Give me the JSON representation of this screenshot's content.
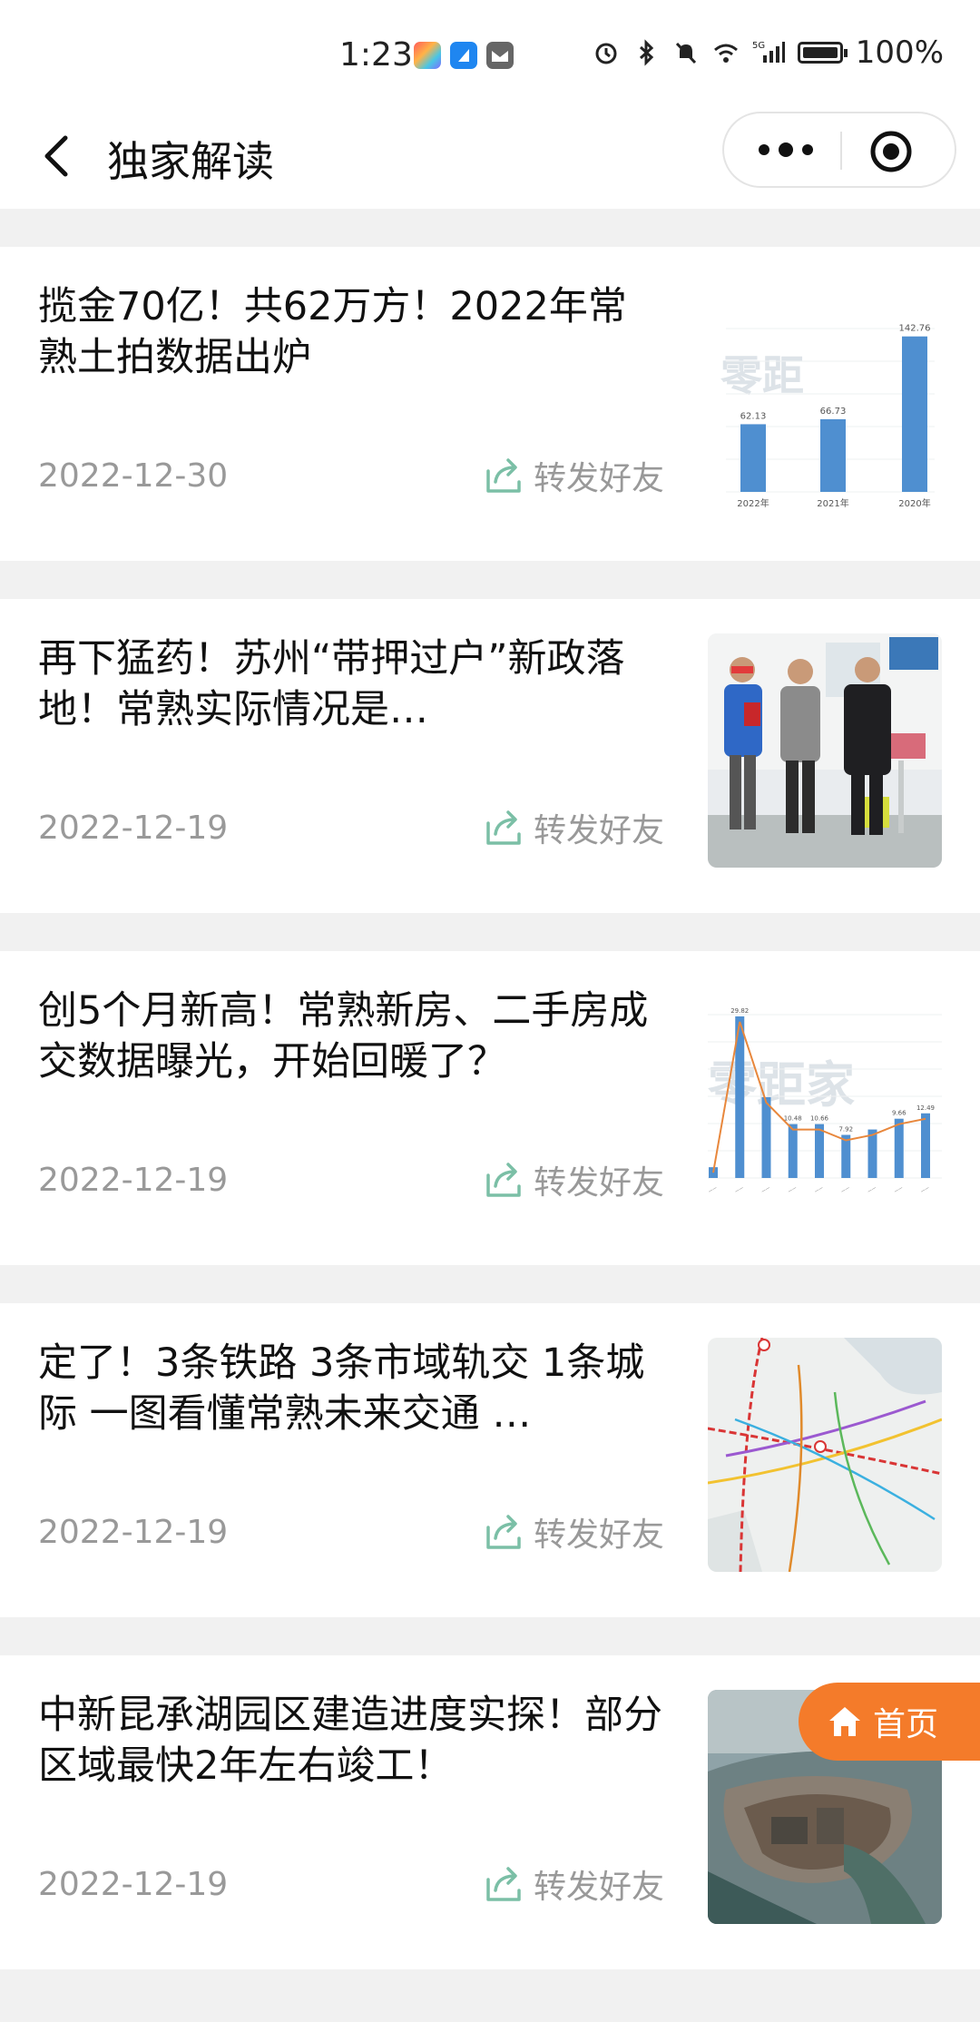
{
  "status_bar": {
    "time": "1:23",
    "battery": "100%",
    "battery_level": 1.0,
    "app_icons": [
      "colorful-app-icon",
      "blue-app-icon",
      "gray-mail-icon"
    ],
    "right_icons": [
      "alarm-icon",
      "bluetooth-icon",
      "mute-icon",
      "wifi-icon",
      "signal-5g-icon"
    ]
  },
  "nav": {
    "title": "独家解读",
    "icons": [
      "back-chevron-icon",
      "more-dots-icon",
      "close-target-icon"
    ]
  },
  "share_label": "转发好友",
  "articles": [
    {
      "title": "揽金70亿！共62万方！2022年常熟土拍数据出炉",
      "date": "2022-12-30",
      "thumb": {
        "kind": "bar-chart",
        "watermark": "零距",
        "categories": [
          "2022年",
          "2021年",
          "2020年"
        ],
        "values": [
          62.13,
          66.73,
          142.76
        ],
        "value_labels": [
          "62.13",
          "66.73",
          "142.76"
        ]
      }
    },
    {
      "title": "再下猛药！苏州“带押过户”新政落地！常熟实际情况是…",
      "date": "2022-12-19",
      "thumb": {
        "kind": "photo",
        "subject": "three men in office holding certificate"
      }
    },
    {
      "title": "创5个月新高！常熟新房、二手房成交数据曝光，开始回暖了？",
      "date": "2022-12-19",
      "thumb": {
        "kind": "bar-line-chart",
        "watermark": "零距家",
        "values": [
          2,
          30,
          15,
          10,
          10,
          8,
          9,
          11,
          12
        ],
        "value_labels": [
          "",
          "29.82",
          "",
          "10.48",
          "10.66",
          "7.92",
          "",
          "9.66",
          "12.49"
        ]
      }
    },
    {
      "title": "定了！3条铁路 3条市域轨交 1条城际 一图看懂常熟未来交通 …",
      "date": "2022-12-19",
      "thumb": {
        "kind": "map",
        "subject": "transit map"
      }
    },
    {
      "title": "中新昆承湖园区建造进度实探！部分区域最快2年左右竣工！",
      "date": "2022-12-19",
      "thumb": {
        "kind": "photo",
        "subject": "aerial construction site by lake"
      }
    }
  ],
  "floating": {
    "home_label": "首页",
    "icon": "home-icon"
  },
  "colors": {
    "share_icon": "#7bbfa6",
    "home_button": "#f47b2a",
    "chart_bar": "#4f8fd0",
    "chart_line": "#e8873c"
  }
}
